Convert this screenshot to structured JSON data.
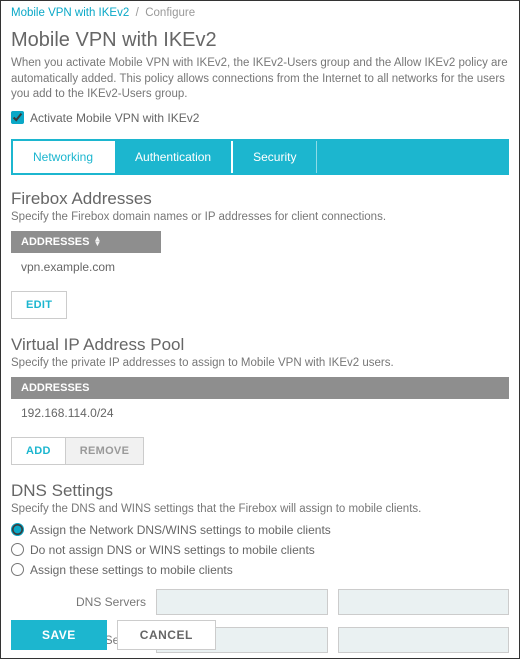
{
  "breadcrumb": {
    "parent": "Mobile VPN with IKEv2",
    "sep": "/",
    "current": "Configure"
  },
  "page": {
    "title": "Mobile VPN with IKEv2",
    "description": "When you activate Mobile VPN with IKEv2, the IKEv2-Users group and the Allow IKEv2 policy are automatically added. This policy allows connections from the Internet to all networks for the users you add to the IKEv2-Users group.",
    "activate_label": "Activate Mobile VPN with IKEv2",
    "activate_checked": true
  },
  "tabs": {
    "networking": "Networking",
    "authentication": "Authentication",
    "security": "Security"
  },
  "firebox": {
    "heading": "Firebox Addresses",
    "sub": "Specify the Firebox domain names or IP addresses for client connections.",
    "col": "ADDRESSES",
    "row": "vpn.example.com",
    "edit": "EDIT"
  },
  "vip": {
    "heading": "Virtual IP Address Pool",
    "sub": "Specify the private IP addresses to assign to Mobile VPN with IKEv2 users.",
    "col": "ADDRESSES",
    "row": "192.168.114.0/24",
    "add": "ADD",
    "remove": "REMOVE"
  },
  "dns": {
    "heading": "DNS Settings",
    "sub": "Specify the DNS and WINS settings that the Firebox will assign to mobile clients.",
    "opt1": "Assign the Network DNS/WINS settings to mobile clients",
    "opt2": "Do not assign DNS or WINS settings to mobile clients",
    "opt3": "Assign these settings to mobile clients",
    "dns_label": "DNS Servers",
    "wins_label": "WINS Servers"
  },
  "footer": {
    "save": "SAVE",
    "cancel": "CANCEL"
  }
}
